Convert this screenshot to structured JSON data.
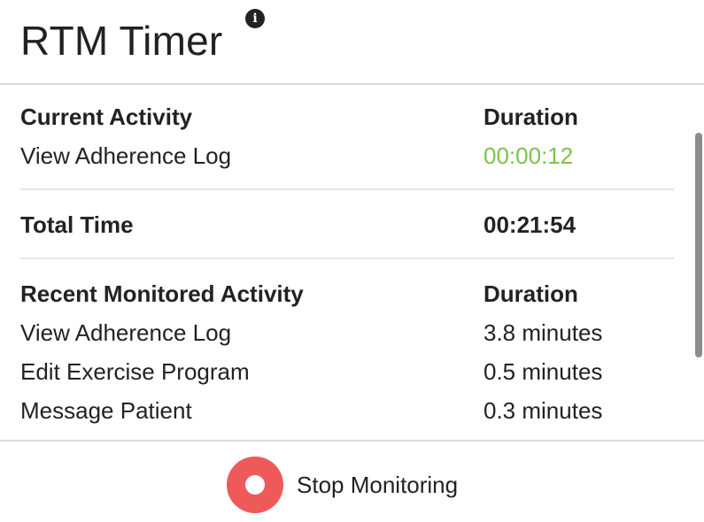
{
  "app": {
    "title": "RTM Timer",
    "info_icon": "info-icon",
    "info_glyph": "i"
  },
  "current": {
    "activity_header": "Current Activity",
    "duration_header": "Duration",
    "activity": "View Adherence Log",
    "duration": "00:00:12",
    "duration_color": "#7cc24a"
  },
  "total": {
    "label": "Total Time",
    "value": "00:21:54"
  },
  "recent": {
    "activity_header": "Recent Monitored Activity",
    "duration_header": "Duration",
    "items": [
      {
        "activity": "View Adherence Log",
        "duration": "3.8 minutes"
      },
      {
        "activity": "Edit Exercise Program",
        "duration": "0.5 minutes"
      },
      {
        "activity": "Message Patient",
        "duration": "0.3 minutes"
      }
    ]
  },
  "footer": {
    "stop_label": "Stop Monitoring",
    "stop_icon": "stop-record-icon",
    "stop_color": "#ee5a5a"
  }
}
